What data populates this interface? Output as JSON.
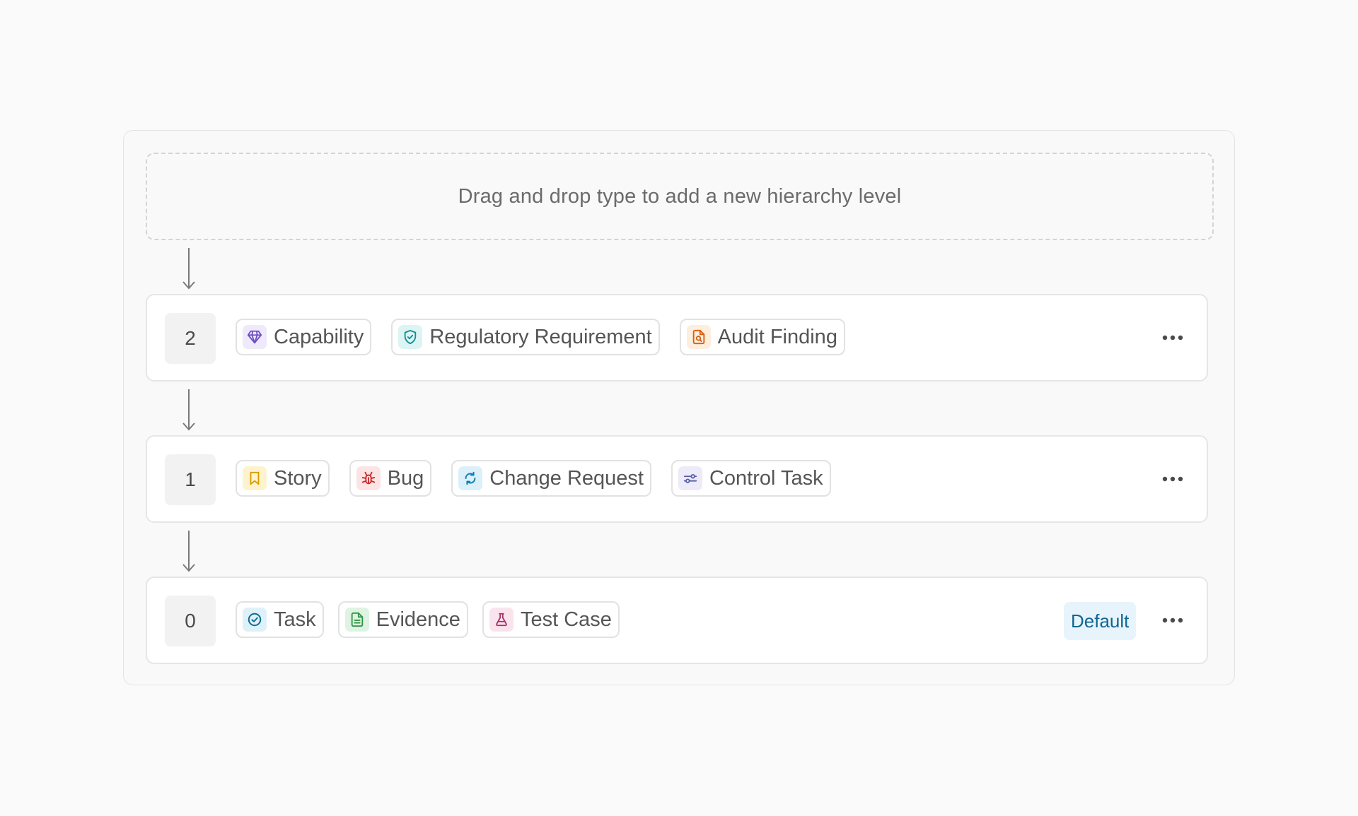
{
  "dropzone": {
    "text": "Drag and drop type to add a new hierarchy level"
  },
  "levels": [
    {
      "number": "2",
      "chips": [
        {
          "label": "Capability",
          "icon": "diamond-icon",
          "color": "#6d4fc2",
          "bg": "#efeafb"
        },
        {
          "label": "Regulatory Requirement",
          "icon": "shield-check-icon",
          "color": "#0f8f8f",
          "bg": "#dcf5f4"
        },
        {
          "label": "Audit Finding",
          "icon": "file-search-icon",
          "color": "#d4600f",
          "bg": "#fdeedd"
        }
      ]
    },
    {
      "number": "1",
      "chips": [
        {
          "label": "Story",
          "icon": "bookmark-icon",
          "color": "#d99a00",
          "bg": "#fdf3cf"
        },
        {
          "label": "Bug",
          "icon": "bug-icon",
          "color": "#c62828",
          "bg": "#fce4e4"
        },
        {
          "label": "Change Request",
          "icon": "refresh-icon",
          "color": "#0d7fb5",
          "bg": "#dcf0fa"
        },
        {
          "label": "Control Task",
          "icon": "sliders-icon",
          "color": "#5a5fa8",
          "bg": "#ecebf7"
        }
      ]
    },
    {
      "number": "0",
      "badge": "Default",
      "chips": [
        {
          "label": "Task",
          "icon": "check-circle-icon",
          "color": "#0d6e95",
          "bg": "#dff1f8"
        },
        {
          "label": "Evidence",
          "icon": "file-text-icon",
          "color": "#2e9444",
          "bg": "#dff3e3"
        },
        {
          "label": "Test Case",
          "icon": "flask-icon",
          "color": "#a8326a",
          "bg": "#f9e4ee"
        }
      ]
    }
  ]
}
